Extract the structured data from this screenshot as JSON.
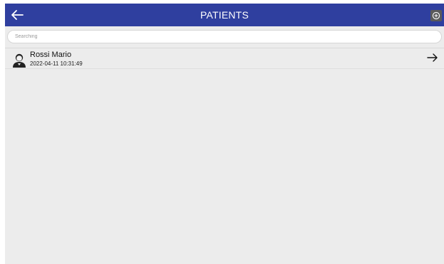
{
  "header": {
    "title": "PATIENTS",
    "back_icon": "arrow-left-icon",
    "add_icon": "plus-circle-icon",
    "background": "#2f3f9f"
  },
  "search": {
    "placeholder": "Searching",
    "value": ""
  },
  "patients": [
    {
      "name": "Rossi Mario",
      "datetime": "2022-04-11 10:31:49",
      "avatar_icon": "person-avatar-icon",
      "open_icon": "arrow-right-icon"
    }
  ]
}
